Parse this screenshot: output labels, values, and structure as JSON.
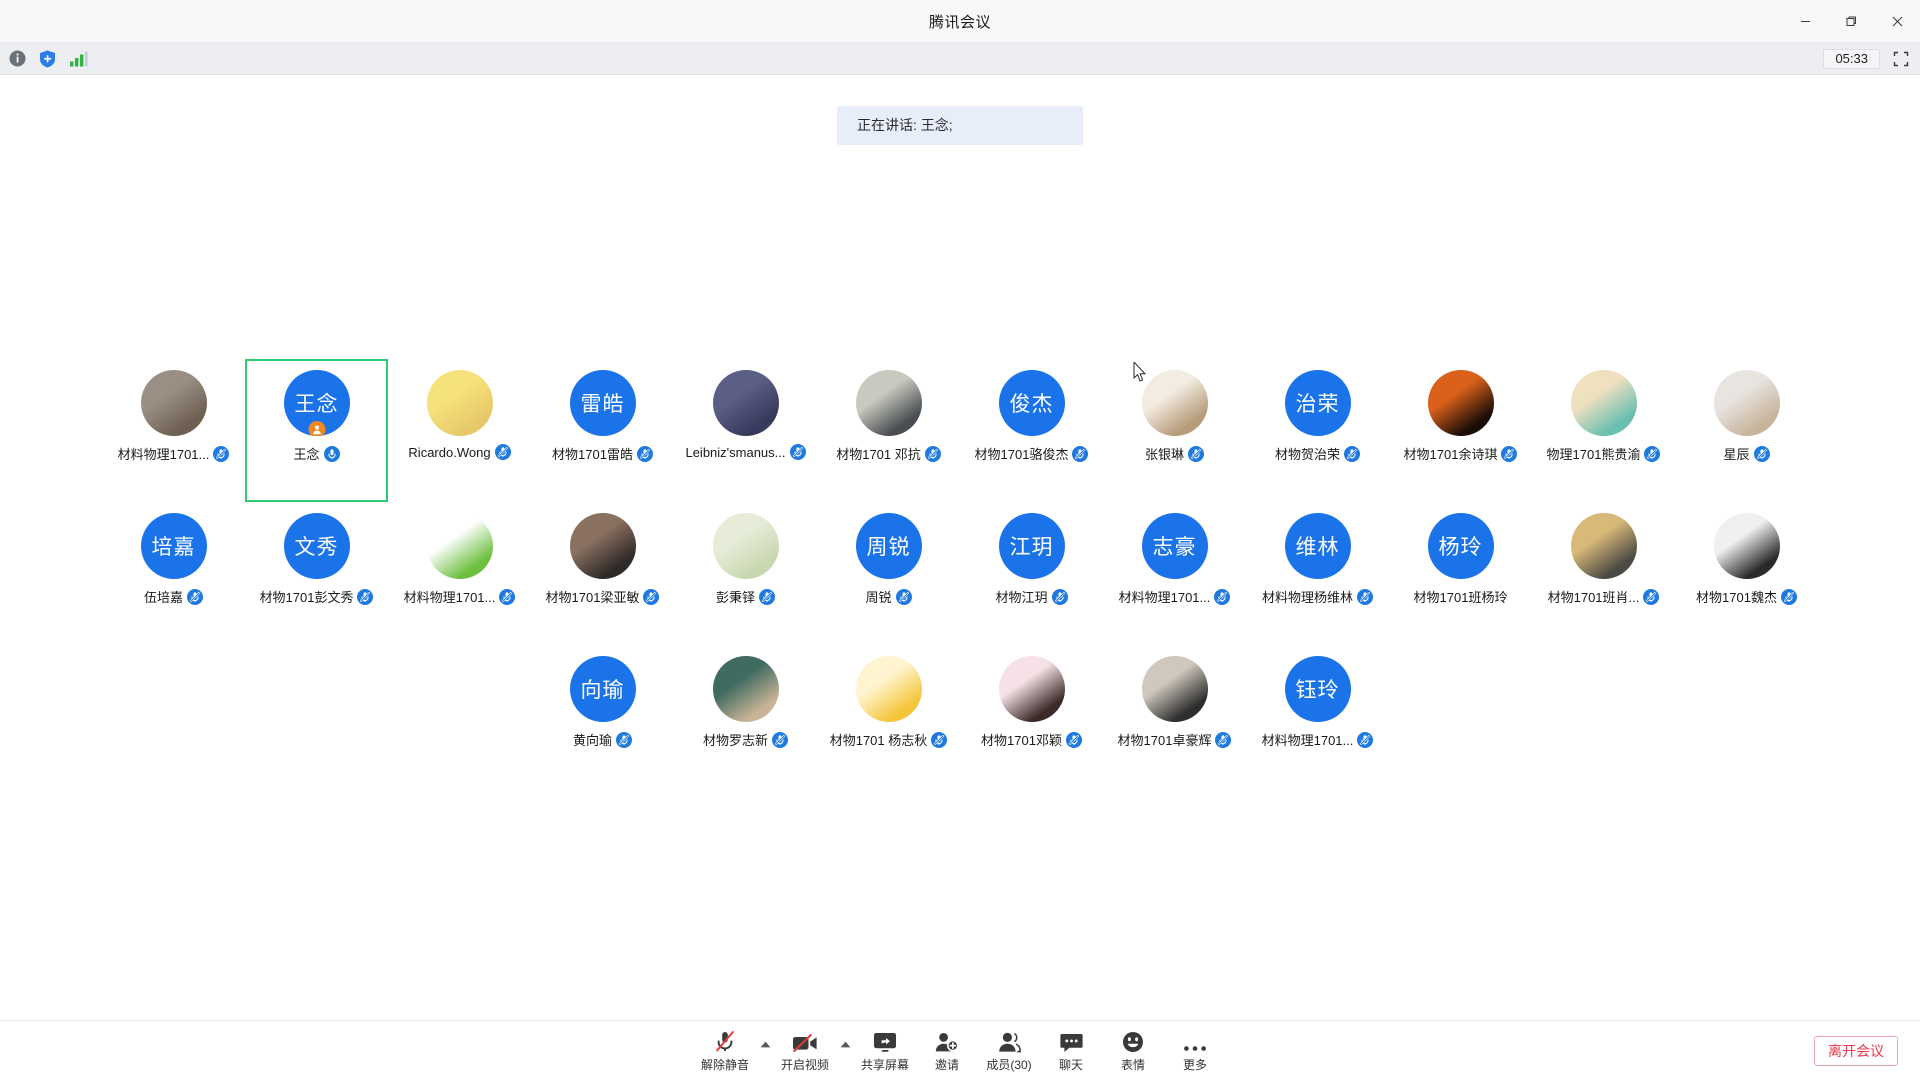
{
  "window": {
    "title": "腾讯会议",
    "minimize_label": "最小化",
    "maximize_label": "最大化",
    "close_label": "关闭"
  },
  "subbar": {
    "info_icon": "info-icon",
    "shield_icon": "shield-add-icon",
    "signal_icon": "network-signal-icon",
    "timer": "05:33",
    "fullscreen_icon": "fullscreen-icon"
  },
  "stage": {
    "speaking_banner": "正在讲话: 王念;"
  },
  "colors": {
    "avatar_blue": "#1a73e8",
    "active_border": "#2ecc71",
    "mic_blue": "#1f7ae0",
    "leave_red": "#e8384f",
    "banner_bg": "#e8eef9"
  },
  "participants": {
    "rows": [
      [
        {
          "name": "材料物理1701...",
          "avatar_type": "image",
          "avatar_colors": [
            "#9b8f84",
            "#6d5f52"
          ],
          "mic": "muted",
          "active": false,
          "host": false
        },
        {
          "name": "王念",
          "avatar_type": "initials",
          "initials": "王念",
          "mic": "on",
          "active": true,
          "host": true
        },
        {
          "name": "Ricardo.Wong",
          "avatar_type": "image",
          "avatar_colors": [
            "#f6e27a",
            "#e8c96a"
          ],
          "mic": "muted",
          "active": false,
          "host": false
        },
        {
          "name": "材物1701雷皓",
          "avatar_type": "initials",
          "initials": "雷皓",
          "mic": "muted",
          "active": false,
          "host": false
        },
        {
          "name": "Leibniz'smanus...",
          "avatar_type": "image",
          "avatar_colors": [
            "#5b5f86",
            "#373a5c"
          ],
          "mic": "muted",
          "active": false,
          "host": false
        },
        {
          "name": "材物1701 邓抗",
          "avatar_type": "image",
          "avatar_colors": [
            "#c8cabf",
            "#4a4e52"
          ],
          "mic": "muted",
          "active": false,
          "host": false
        },
        {
          "name": "材物1701骆俊杰",
          "avatar_type": "initials",
          "initials": "俊杰",
          "mic": "muted",
          "active": false,
          "host": false
        },
        {
          "name": "张银琳",
          "avatar_type": "image",
          "avatar_colors": [
            "#f3ece2",
            "#b79c7a"
          ],
          "mic": "muted",
          "active": false,
          "host": false
        },
        {
          "name": "材物贺治荣",
          "avatar_type": "initials",
          "initials": "治荣",
          "mic": "muted",
          "active": false,
          "host": false
        },
        {
          "name": "材物1701余诗琪",
          "avatar_type": "image",
          "avatar_colors": [
            "#d9611a",
            "#1a0d08"
          ],
          "mic": "muted",
          "active": false,
          "host": false
        },
        {
          "name": "物理1701熊贵渝",
          "avatar_type": "image",
          "avatar_colors": [
            "#efe0c0",
            "#6bbfb0"
          ],
          "mic": "muted",
          "active": false,
          "host": false
        },
        {
          "name": "星辰",
          "avatar_type": "image",
          "avatar_colors": [
            "#e8e4e0",
            "#c8b49c"
          ],
          "mic": "muted",
          "active": false,
          "host": false
        }
      ],
      [
        {
          "name": "伍培嘉",
          "avatar_type": "initials",
          "initials": "培嘉",
          "mic": "muted",
          "active": false,
          "host": false
        },
        {
          "name": "材物1701彭文秀",
          "avatar_type": "initials",
          "initials": "文秀",
          "mic": "muted",
          "active": false,
          "host": false
        },
        {
          "name": "材料物理1701...",
          "avatar_type": "image",
          "avatar_colors": [
            "#ffffff",
            "#6cbf3f"
          ],
          "mic": "muted",
          "active": false,
          "host": false
        },
        {
          "name": "材物1701梁亚敏",
          "avatar_type": "image",
          "avatar_colors": [
            "#8a7060",
            "#2e2a28"
          ],
          "mic": "muted",
          "active": false,
          "host": false
        },
        {
          "name": "彭秉铎",
          "avatar_type": "image",
          "avatar_colors": [
            "#e6ecd8",
            "#c9d7b0"
          ],
          "mic": "muted",
          "active": false,
          "host": false
        },
        {
          "name": "周锐",
          "avatar_type": "initials",
          "initials": "周锐",
          "mic": "muted",
          "active": false,
          "host": false
        },
        {
          "name": "材物江玥",
          "avatar_type": "initials",
          "initials": "江玥",
          "mic": "muted",
          "active": false,
          "host": false
        },
        {
          "name": "材料物理1701...",
          "avatar_type": "initials",
          "initials": "志豪",
          "mic": "muted",
          "active": false,
          "host": false
        },
        {
          "name": "材料物理杨维林",
          "avatar_type": "initials",
          "initials": "维林",
          "mic": "muted",
          "active": false,
          "host": false
        },
        {
          "name": "材物1701班杨玲",
          "avatar_type": "initials",
          "initials": "杨玲",
          "mic": "none",
          "active": false,
          "host": false
        },
        {
          "name": "材物1701班肖...",
          "avatar_type": "image",
          "avatar_colors": [
            "#d8b978",
            "#4c4a44"
          ],
          "mic": "muted",
          "active": false,
          "host": false
        },
        {
          "name": "材物1701魏杰",
          "avatar_type": "image",
          "avatar_colors": [
            "#f0f0f0",
            "#2a2a2a"
          ],
          "mic": "muted",
          "active": false,
          "host": false
        }
      ],
      [
        {
          "name": "黄向瑜",
          "avatar_type": "initials",
          "initials": "向瑜",
          "mic": "muted",
          "active": false,
          "host": false
        },
        {
          "name": "材物罗志新",
          "avatar_type": "image",
          "avatar_colors": [
            "#3f6b60",
            "#c9b396"
          ],
          "mic": "muted",
          "active": false,
          "host": false
        },
        {
          "name": "材物1701 杨志秋",
          "avatar_type": "image",
          "avatar_colors": [
            "#fff4d0",
            "#f5c63a"
          ],
          "mic": "muted",
          "active": false,
          "host": false
        },
        {
          "name": "材物1701邓颖",
          "avatar_type": "image",
          "avatar_colors": [
            "#f6e2e6",
            "#3a2a28"
          ],
          "mic": "muted",
          "active": false,
          "host": false
        },
        {
          "name": "材物1701卓豪辉",
          "avatar_type": "image",
          "avatar_colors": [
            "#cfc8bd",
            "#2e2e2e"
          ],
          "mic": "muted",
          "active": false,
          "host": false
        },
        {
          "name": "材料物理1701...",
          "avatar_type": "initials",
          "initials": "钰玲",
          "mic": "muted",
          "active": false,
          "host": false
        }
      ]
    ]
  },
  "toolbar": {
    "items": [
      {
        "label": "解除静音",
        "icon": "mic-muted-icon",
        "has_caret": true
      },
      {
        "label": "开启视频",
        "icon": "video-off-icon",
        "has_caret": true
      },
      {
        "label": "共享屏幕",
        "icon": "share-screen-icon",
        "has_caret": false
      },
      {
        "label": "邀请",
        "icon": "invite-user-icon",
        "has_caret": false
      },
      {
        "label": "成员(30)",
        "icon": "members-icon",
        "has_caret": false
      },
      {
        "label": "聊天",
        "icon": "chat-bubble-icon",
        "has_caret": false
      },
      {
        "label": "表情",
        "icon": "emoji-icon",
        "has_caret": false
      },
      {
        "label": "更多",
        "icon": "more-dots-icon",
        "has_caret": false
      }
    ],
    "leave_label": "离开会议"
  }
}
